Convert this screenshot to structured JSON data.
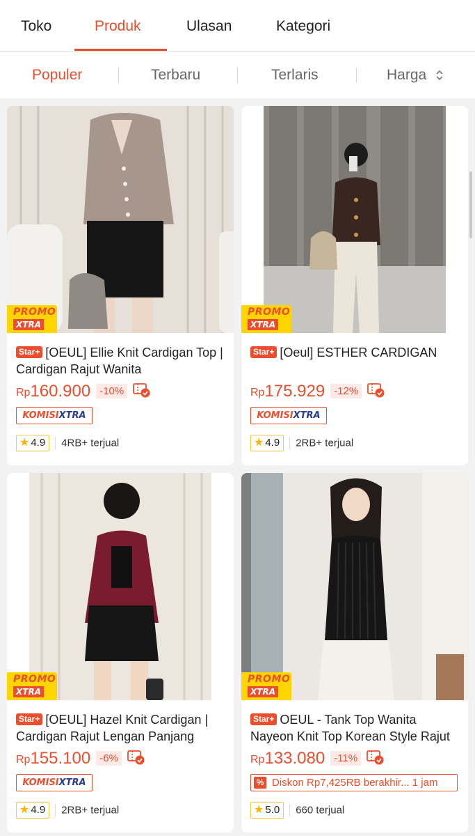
{
  "tabs": [
    {
      "label": "Toko",
      "active": false
    },
    {
      "label": "Produk",
      "active": true
    },
    {
      "label": "Ulasan",
      "active": false
    },
    {
      "label": "Kategori",
      "active": false
    }
  ],
  "sort": {
    "items": [
      {
        "label": "Populer",
        "active": true
      },
      {
        "label": "Terbaru",
        "active": false
      },
      {
        "label": "Terlaris",
        "active": false
      },
      {
        "label": "Harga",
        "active": false
      }
    ],
    "price_sort_icon": "sort-arrows-icon"
  },
  "colors": {
    "accent": "#ee4d2d",
    "promo_yellow": "#ffd500",
    "komisi_blue": "#2a3c8e",
    "rating_star": "#ffb400"
  },
  "promo_badge": {
    "line1": "PROMO",
    "line2": "XTRA"
  },
  "star_badge": "Star+",
  "currency": "Rp",
  "products": [
    {
      "title": "[OEUL] Ellie Knit Cardigan Top | Cardigan Rajut Wanita",
      "price": "160.900",
      "discount": "-10%",
      "komisi": {
        "part1": "KOMISI",
        "part2": "XTRA"
      },
      "rating": "4.9",
      "sold": "4RB+ terjual",
      "image": "woman in taupe v-neck knit cardigan and black skirt"
    },
    {
      "title": "[Oeul] ESTHER CARDIGAN",
      "price": "175.929",
      "discount": "-12%",
      "komisi": {
        "part1": "KOMISI",
        "part2": "XTRA"
      },
      "rating": "4.9",
      "sold": "2RB+ terjual",
      "image": "woman mirror selfie in dark brown cardigan and white trousers"
    },
    {
      "title": "[OEUL] Hazel Knit Cardigan | Cardigan Rajut Lengan Panjang",
      "price": "155.100",
      "discount": "-6%",
      "komisi": {
        "part1": "KOMISI",
        "part2": "XTRA"
      },
      "rating": "4.9",
      "sold": "2RB+ terjual",
      "image": "woman in burgundy cardigan and black skirt"
    },
    {
      "title": "OEUL - Tank Top Wanita Nayeon Knit Top Korean Style Rajut",
      "price": "133.080",
      "discount": "-11%",
      "diskon": "Diskon Rp7,425RB berakhir... 1 jam",
      "rating": "5.0",
      "sold": "660 terjual",
      "image": "woman in black ribbed knit tank top and white trousers"
    }
  ]
}
